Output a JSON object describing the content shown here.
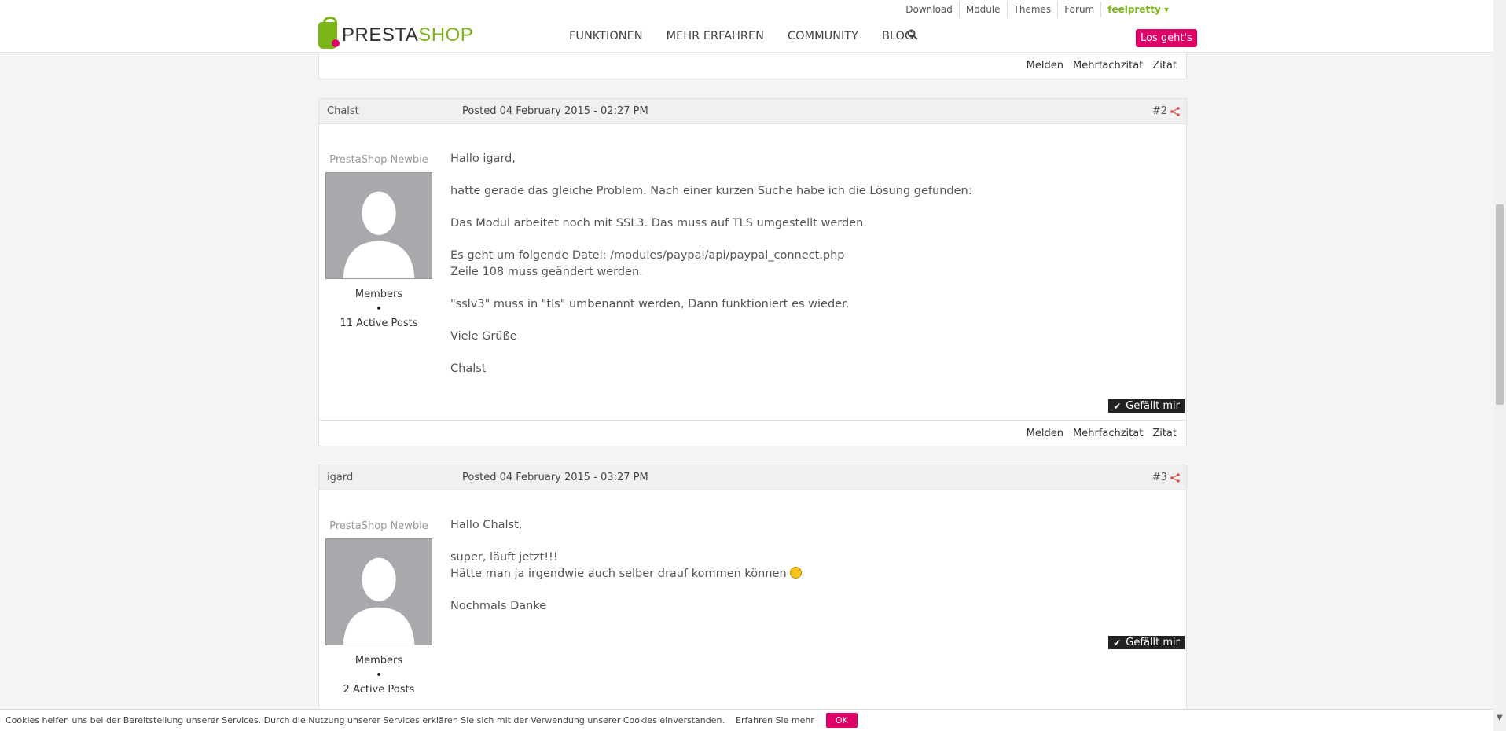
{
  "toplinks": [
    "Download",
    "Module",
    "Themes",
    "Forum",
    "feelpretty ▾"
  ],
  "logo": {
    "presta": "PRESTA",
    "shop": "SHOP"
  },
  "nav": [
    "FUNKTIONEN",
    "MEHR ERFAHREN",
    "COMMUNITY",
    "BLOG"
  ],
  "cta": "Los geht's",
  "actions": {
    "report": "Melden",
    "multiquote": "Mehrfachzitat",
    "quote": "Zitat"
  },
  "posts": [
    {
      "author": "Chalst",
      "date": "Posted 04 February 2015 - 02:27 PM",
      "number": "#2",
      "rank": "PrestaShop Newbie",
      "group": "Members",
      "bullet": "•",
      "active_posts": "11 Active Posts",
      "lines": [
        "Hallo igard,",
        "hatte gerade das gleiche Problem. Nach einer kurzen Suche habe ich die Lösung gefunden:",
        "Das Modul arbeitet noch mit SSL3. Das muss auf TLS umgestellt werden.",
        "Es geht um folgende Datei: /modules/paypal/api/paypal_connect.php",
        "Zeile 108 muss geändert werden.",
        "\"sslv3\" muss in \"tls\" umbenannt werden, Dann funktioniert es wieder.",
        "Viele Grüße",
        "Chalst"
      ],
      "like": "Gefällt mir"
    },
    {
      "author": "igard",
      "date": "Posted 04 February 2015 - 03:27 PM",
      "number": "#3",
      "rank": "PrestaShop Newbie",
      "group": "Members",
      "bullet": "•",
      "active_posts": "2 Active Posts",
      "lines": [
        "Hallo Chalst,",
        "super, läuft jetzt!!!",
        "Hätte man ja irgendwie auch selber drauf kommen können",
        "Nochmals Danke"
      ],
      "like": "Gefällt mir"
    }
  ],
  "cookie": {
    "text": "Cookies helfen uns bei der Bereitstellung unserer Services. Durch die Nutzung unserer Services erklären Sie sich mit der Verwendung unserer Cookies einverstanden.",
    "more": "Erfahren Sie mehr",
    "ok": "OK"
  },
  "colors": {
    "brand_green": "#7cb518",
    "brand_pink": "#df0067"
  }
}
